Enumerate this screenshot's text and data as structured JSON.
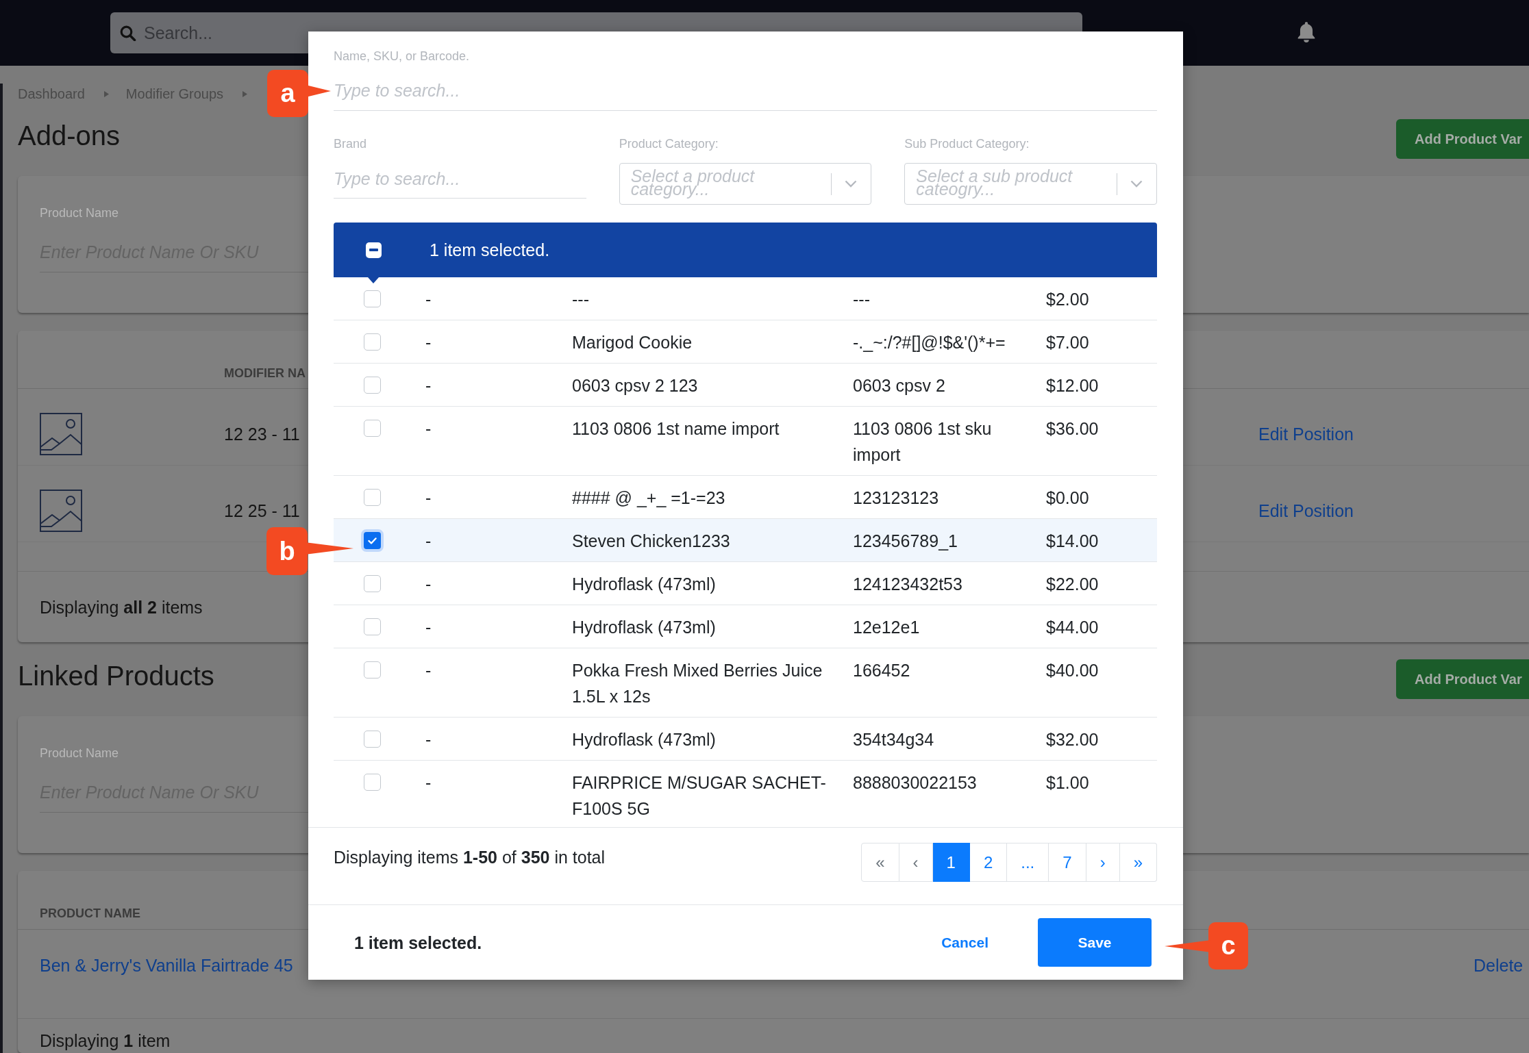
{
  "top_bar": {
    "search": {
      "placeholder": "Search..."
    }
  },
  "breadcrumbs": [
    {
      "label": "Dashboard"
    },
    {
      "label": "Modifier Groups"
    }
  ],
  "sections": [
    {
      "kind": "modifiers",
      "title": "Add-ons",
      "add_button": "Add Product Var",
      "filter": {
        "label": "Product Name",
        "placeholder": "Enter Product Name Or SKU"
      },
      "table": {
        "columns": [
          "MODIFIER NA"
        ],
        "rows": [
          {
            "name": "12 23 - 11",
            "action": "Edit Position"
          },
          {
            "name": "12 25 - 11",
            "action": "Edit Position"
          }
        ]
      },
      "footer": "Displaying **all 2** items"
    },
    {
      "kind": "products",
      "title": "Linked Products",
      "add_button": "Add Product Var",
      "filter": {
        "label": "Product Name",
        "placeholder": "Enter Product Name Or SKU"
      },
      "table": {
        "columns": [
          "PRODUCT NAME"
        ],
        "rows": [
          {
            "name": "Ben & Jerry's Vanilla Fairtrade 45",
            "action": "Delete"
          }
        ]
      },
      "footer": "Displaying **1** item"
    }
  ],
  "modal": {
    "search": {
      "label": "Name, SKU, or Barcode.",
      "placeholder": "Type to search..."
    },
    "filters": [
      {
        "kind": "text",
        "label": "Brand",
        "placeholder": "Type to search..."
      },
      {
        "kind": "select",
        "label": "Product Category:",
        "placeholder": "Select a product category..."
      },
      {
        "kind": "select",
        "label": "Sub Product Category:",
        "placeholder": "Select a sub product cateogry..."
      }
    ],
    "selection_bar": {
      "indeterminate": true,
      "text": "1 item selected."
    },
    "rows": [
      {
        "checked": false,
        "column_2": "-",
        "column_3": "---",
        "column_4": "---",
        "column_5": "$2.00"
      },
      {
        "checked": false,
        "column_2": "-",
        "column_3": "Marigod Cookie",
        "column_4": "-._~:/?#[]@!$&'()*+=",
        "column_5": "$7.00"
      },
      {
        "checked": false,
        "column_2": "-",
        "column_3": "0603 cpsv 2 123",
        "column_4": "0603 cpsv 2",
        "column_5": "$12.00"
      },
      {
        "checked": false,
        "column_2": "-",
        "column_3": "1103 0806 1st name import",
        "column_4": "1103 0806 1st sku import",
        "column_5": "$36.00"
      },
      {
        "checked": false,
        "column_2": "-",
        "column_3": "#### @ _+_ =1-=23",
        "column_4": "123123123",
        "column_5": "$0.00"
      },
      {
        "checked": true,
        "column_2": "-",
        "column_3": "Steven Chicken1233",
        "column_4": "123456789_1",
        "column_5": "$14.00"
      },
      {
        "checked": false,
        "column_2": "-",
        "column_3": "Hydroflask (473ml)",
        "column_4": "124123432t53",
        "column_5": "$22.00"
      },
      {
        "checked": false,
        "column_2": "-",
        "column_3": "Hydroflask (473ml)",
        "column_4": "12e12e1",
        "column_5": "$44.00"
      },
      {
        "checked": false,
        "column_2": "-",
        "column_3": "Pokka Fresh Mixed Berries Juice 1.5L x 12s",
        "column_4": "166452",
        "column_5": "$40.00"
      },
      {
        "checked": false,
        "column_2": "-",
        "column_3": "Hydroflask (473ml)",
        "column_4": "354t34g34",
        "column_5": "$32.00"
      },
      {
        "checked": false,
        "column_2": "-",
        "column_3": "FAIRPRICE M/SUGAR SACHET-F100S 5G",
        "column_4": "8888030022153",
        "column_5": "$1.00"
      }
    ],
    "summary": "Displaying items **1-50** of **350** in total",
    "pagination": [
      {
        "label": "«",
        "selected": false,
        "disabled": true
      },
      {
        "label": "‹",
        "selected": false,
        "disabled": true
      },
      {
        "label": "1",
        "selected": true,
        "disabled": false
      },
      {
        "label": "2",
        "selected": false,
        "disabled": false
      },
      {
        "label": "...",
        "selected": false,
        "disabled": false
      },
      {
        "label": "7",
        "selected": false,
        "disabled": false
      },
      {
        "label": "›",
        "selected": false,
        "disabled": false
      },
      {
        "label": "»",
        "selected": false,
        "disabled": false
      }
    ],
    "footer": {
      "status": "1 item selected.",
      "cancel": "Cancel",
      "save": "Save"
    }
  },
  "callouts": [
    {
      "label": "a"
    },
    {
      "label": "b"
    },
    {
      "label": "c"
    }
  ]
}
